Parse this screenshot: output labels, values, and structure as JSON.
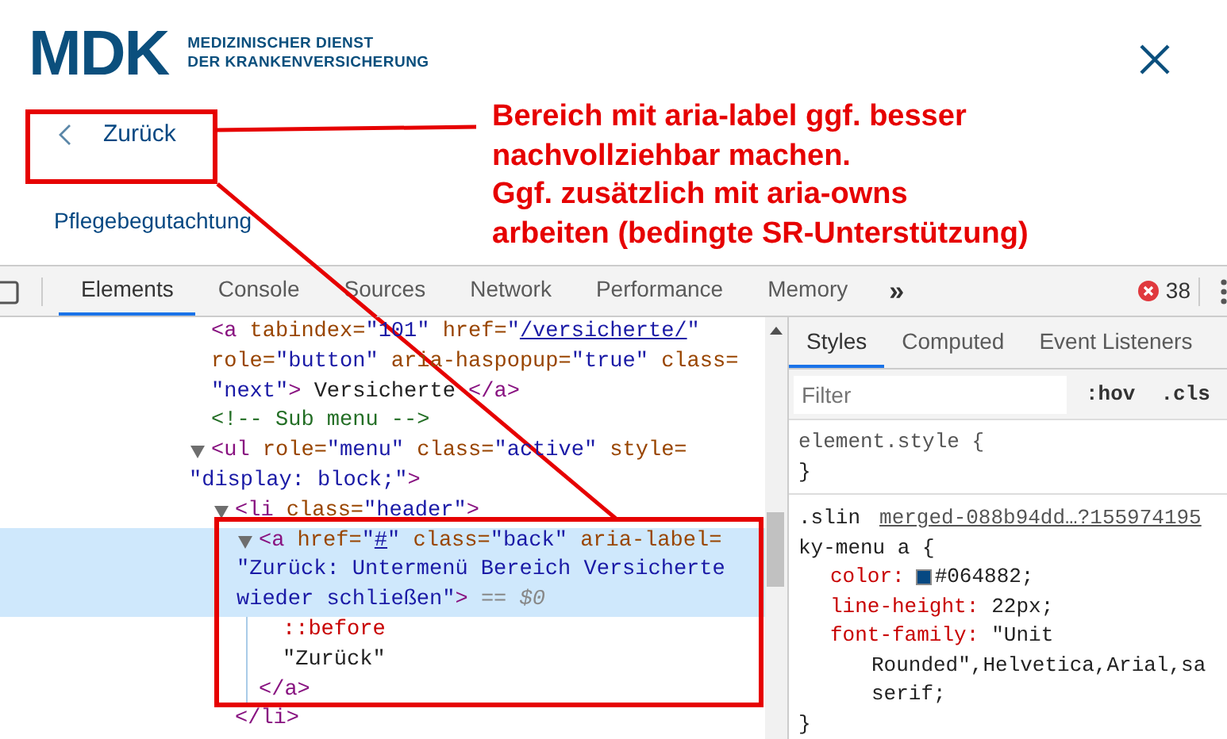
{
  "header": {
    "logo": {
      "wordmark": "MDK",
      "tagline": [
        "MEDIZINISCHER DIENST",
        "DER KRANKENVERSICHERUNG"
      ]
    },
    "back_link": "Zurück",
    "menu_item": "Pflegebegutachtung"
  },
  "annotation": {
    "lines": [
      "Bereich mit aria-label ggf. besser",
      "nachvollziehbar machen.",
      "Ggf. zusätzlich mit aria-owns",
      "arbeiten (bedingte SR-Unterstützung)"
    ]
  },
  "devtools": {
    "tabs": [
      {
        "label": "Elements",
        "selected": true
      },
      {
        "label": "Console",
        "selected": false
      },
      {
        "label": "Sources",
        "selected": false
      },
      {
        "label": "Network",
        "selected": false
      },
      {
        "label": "Performance",
        "selected": false
      },
      {
        "label": "Memory",
        "selected": false
      }
    ],
    "more_tabs": "»",
    "error_count": "38",
    "dom_tree": [
      {
        "selected": false,
        "lines": [
          [
            {
              "kind": "tag",
              "text": "<a"
            },
            {
              "kind": "attr",
              "text": " tabindex="
            },
            {
              "kind": "value",
              "text": "\"101\""
            },
            {
              "kind": "attr",
              "text": " href="
            },
            {
              "kind": "value",
              "text": "\""
            },
            {
              "kind": "link",
              "text": "/versicherte/"
            },
            {
              "kind": "value",
              "text": "\""
            }
          ],
          [
            {
              "kind": "attr",
              "text": "role="
            },
            {
              "kind": "value",
              "text": "\"button\""
            },
            {
              "kind": "attr",
              "text": " aria-haspopup="
            },
            {
              "kind": "value",
              "text": "\"true\""
            },
            {
              "kind": "attr",
              "text": " class="
            }
          ],
          [
            {
              "kind": "value",
              "text": "\"next\""
            },
            {
              "kind": "tag",
              "text": ">"
            },
            {
              "kind": "text",
              "text": " Versicherte "
            },
            {
              "kind": "tag",
              "text": "</a>"
            }
          ]
        ]
      },
      {
        "selected": false,
        "lines": [
          [
            {
              "kind": "comment",
              "text": "<!-- Sub menu -->"
            }
          ]
        ]
      },
      {
        "selected": false,
        "expanded": true,
        "lines": [
          [
            {
              "kind": "tag",
              "text": "<ul"
            },
            {
              "kind": "attr",
              "text": " role="
            },
            {
              "kind": "value",
              "text": "\"menu\""
            },
            {
              "kind": "attr",
              "text": " class="
            },
            {
              "kind": "value",
              "text": "\"active\""
            },
            {
              "kind": "attr",
              "text": " style="
            }
          ],
          [
            {
              "kind": "value",
              "text": "\"display: block;\""
            },
            {
              "kind": "tag",
              "text": ">"
            }
          ]
        ],
        "children": [
          {
            "selected": false,
            "expanded": true,
            "lines": [
              [
                {
                  "kind": "tag",
                  "text": "<li"
                },
                {
                  "kind": "attr",
                  "text": " class="
                },
                {
                  "kind": "value",
                  "text": "\"header\""
                },
                {
                  "kind": "tag",
                  "text": ">"
                }
              ]
            ],
            "children": [
              {
                "selected": true,
                "expanded": true,
                "lines": [
                  [
                    {
                      "kind": "tag",
                      "text": "<a"
                    },
                    {
                      "kind": "attr",
                      "text": " href="
                    },
                    {
                      "kind": "value",
                      "text": "\""
                    },
                    {
                      "kind": "link",
                      "text": "#"
                    },
                    {
                      "kind": "value",
                      "text": "\""
                    },
                    {
                      "kind": "attr",
                      "text": " class="
                    },
                    {
                      "kind": "value",
                      "text": "\"back\""
                    },
                    {
                      "kind": "attr",
                      "text": " aria-label="
                    }
                  ],
                  [
                    {
                      "kind": "value",
                      "text": "\"Zurück: Untermenü Bereich Versicherte"
                    }
                  ],
                  [
                    {
                      "kind": "value",
                      "text": "wieder schließen\""
                    },
                    {
                      "kind": "tag",
                      "text": ">"
                    },
                    {
                      "kind": "hint",
                      "text": " == $0"
                    }
                  ]
                ],
                "children": [
                  {
                    "selected": false,
                    "lines": [
                      [
                        {
                          "kind": "pseudo",
                          "text": "::before"
                        }
                      ]
                    ]
                  },
                  {
                    "selected": false,
                    "lines": [
                      [
                        {
                          "kind": "text",
                          "text": "\"Zurück\""
                        }
                      ]
                    ]
                  }
                ],
                "closing": [
                  {
                    "kind": "tag",
                    "text": "</a>"
                  }
                ]
              }
            ],
            "closing": [
              {
                "kind": "tag",
                "text": "</li>"
              }
            ]
          }
        ]
      }
    ],
    "styles_panel": {
      "tabs": [
        {
          "label": "Styles",
          "selected": true
        },
        {
          "label": "Computed",
          "selected": false
        },
        {
          "label": "Event Listeners",
          "selected": false
        }
      ],
      "filter": {
        "placeholder": "Filter"
      },
      "toggles": [
        ":hov",
        ".cls"
      ],
      "rules": [
        {
          "selector_lines": [
            "element.style {"
          ],
          "closing": "}"
        },
        {
          "selector_lines": [
            ".slin",
            "ky-menu a {"
          ],
          "source": "merged-088b94dd…?155974195",
          "declarations": [
            {
              "property": "color:",
              "color": "#064882",
              "value_lines": [
                "#064882;"
              ]
            },
            {
              "property": "line-height:",
              "value_lines": [
                "22px;"
              ]
            },
            {
              "property": "font-family:",
              "value_lines": [
                "\"Unit",
                "Rounded\",Helvetica,Arial,sa",
                "serif;"
              ]
            }
          ],
          "closing": "}"
        }
      ]
    }
  }
}
